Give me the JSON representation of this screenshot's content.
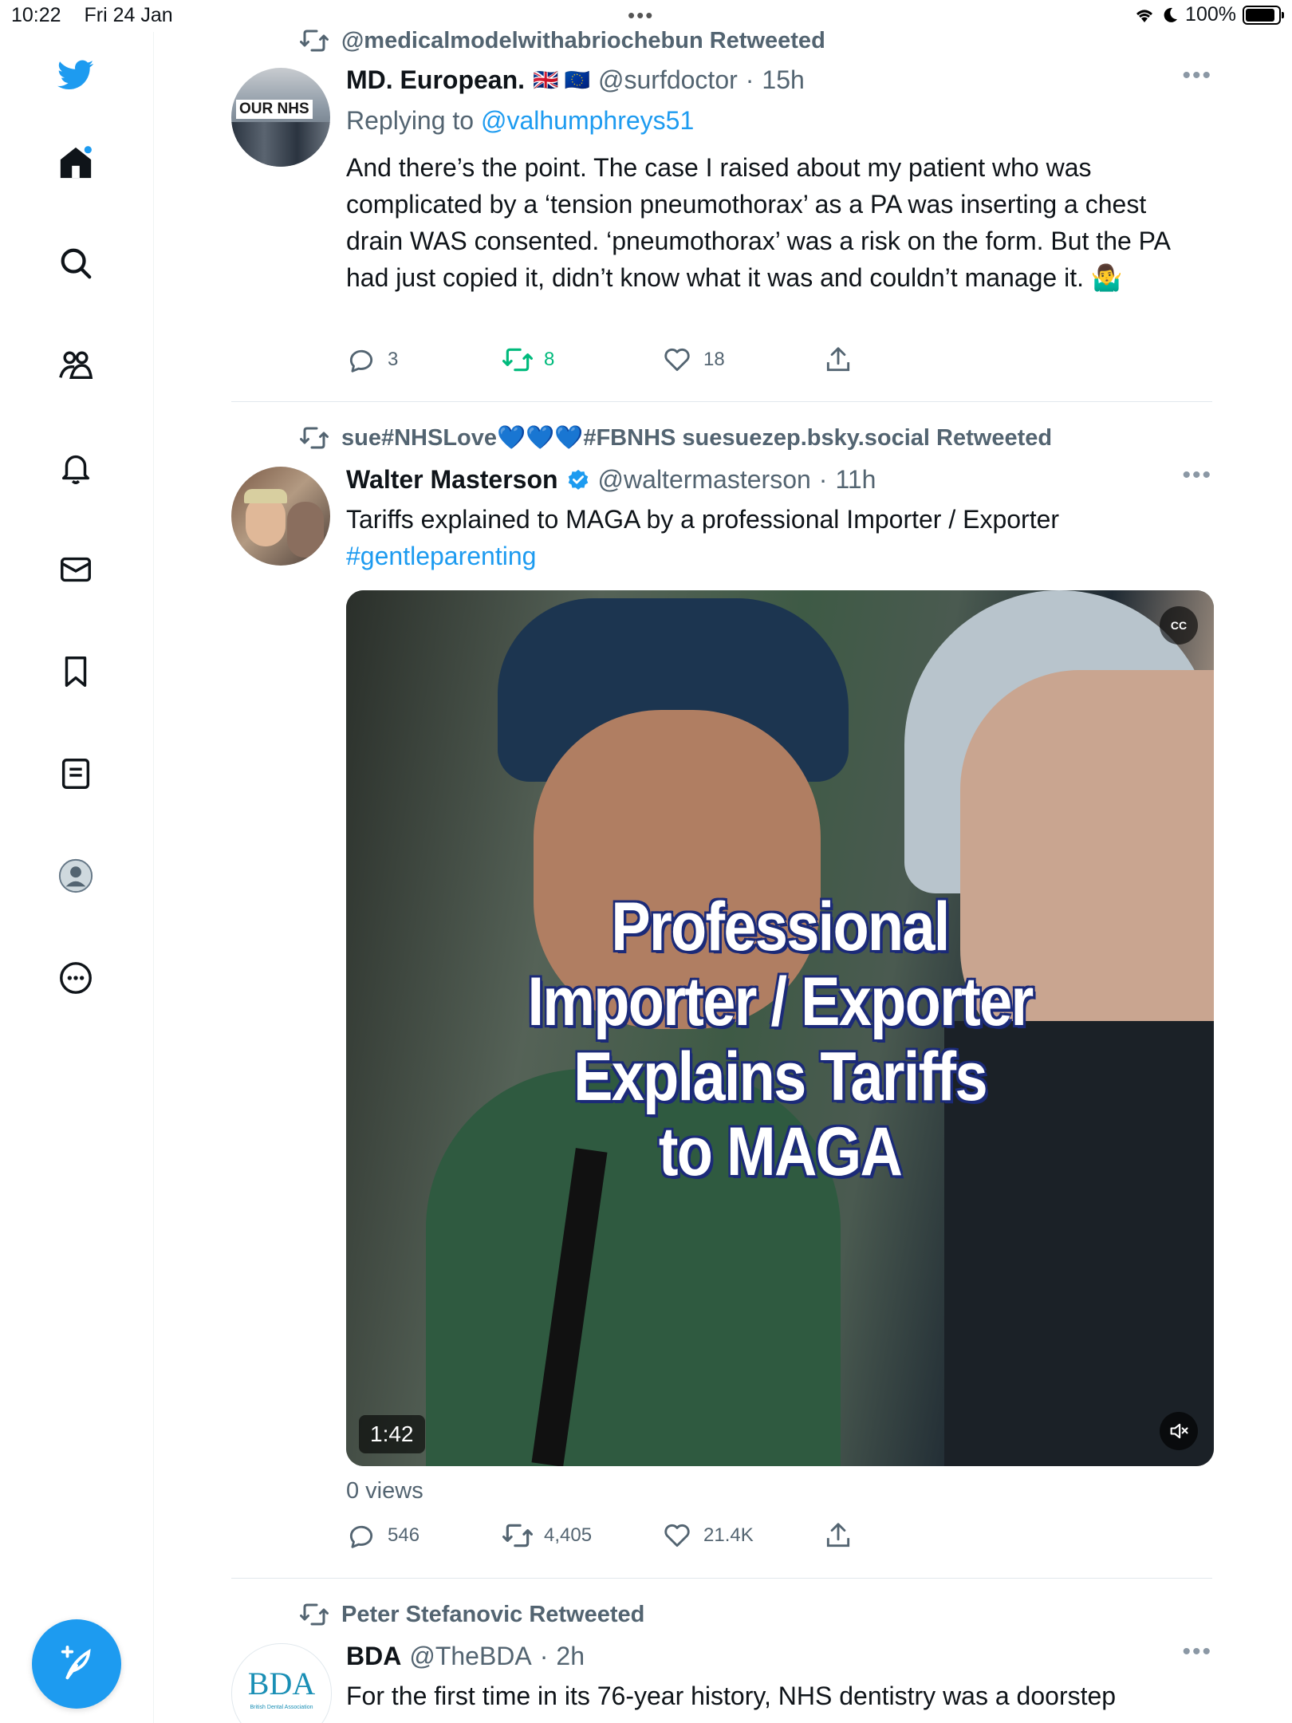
{
  "status_bar": {
    "time": "10:22",
    "date": "Fri 24 Jan",
    "battery": "100%",
    "battery_level": 1.0
  },
  "sidebar": {
    "items": [
      "home-icon",
      "search-icon",
      "communities-icon",
      "notifications-icon",
      "messages-icon",
      "bookmarks-icon",
      "lists-icon",
      "profile-icon",
      "more-icon"
    ],
    "accent": "#1d9bf0"
  },
  "tweets": [
    {
      "retweeted_by": "@medicalmodelwithabriochebun Retweeted",
      "name": "MD. European.",
      "flags": "🇬🇧 🇪🇺",
      "handle": "@surfdoctor",
      "sep": "·",
      "time": "15h",
      "replying_prefix": "Replying to",
      "replying_to": "@valhumphreys51",
      "text": "And there’s the point. The case I raised about my patient who was complicated by a ‘tension pneumothorax’ as a PA was inserting a chest drain WAS consented. ‘pneumothorax’ was a risk on the form. But the PA had just copied it, didn’t know what it was and couldn’t manage it. 🤷‍♂️",
      "avatar_text": "OUR NHS",
      "replies": "3",
      "retweets": "8",
      "likes": "18"
    },
    {
      "retweeted_by": "sue#NHSLove💙💙💙#FBNHS suesuezep.bsky.social Retweeted",
      "name": "Walter Masterson",
      "handle": "@waltermasterson",
      "sep": "·",
      "time": "11h",
      "text": "Tariffs explained to MAGA by a professional Importer / Exporter",
      "hashtag": "#gentleparenting",
      "video": {
        "line1": "Professional",
        "line2": "Importer / Exporter",
        "line3": "Explains Tariffs",
        "line4": "to MAGA",
        "duration": "1:42",
        "cc": "CC"
      },
      "views": "0 views",
      "replies": "546",
      "retweets": "4,405",
      "likes": "21.4K"
    },
    {
      "retweeted_by": "Peter Stefanovic Retweeted",
      "name": "BDA",
      "handle": "@TheBDA",
      "sep": "·",
      "time": "2h",
      "avatar_text": "BDA",
      "avatar_sub": "British Dental Association",
      "text": "For the first time in its 76-year history, NHS dentistry was a doorstep"
    }
  ]
}
